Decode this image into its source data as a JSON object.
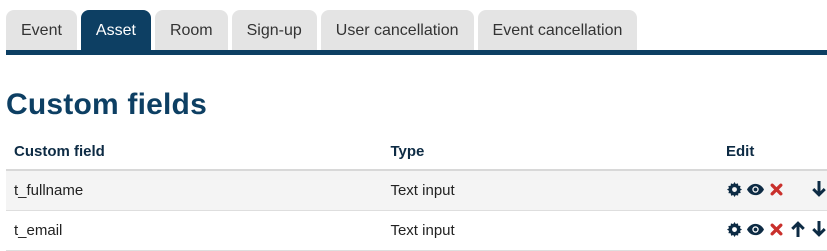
{
  "tabs": [
    {
      "label": "Event",
      "active": false
    },
    {
      "label": "Asset",
      "active": true
    },
    {
      "label": "Room",
      "active": false
    },
    {
      "label": "Sign-up",
      "active": false
    },
    {
      "label": "User cancellation",
      "active": false
    },
    {
      "label": "Event cancellation",
      "active": false
    }
  ],
  "page_title": "Custom fields",
  "table": {
    "headers": {
      "field": "Custom field",
      "type": "Type",
      "edit": "Edit"
    },
    "rows": [
      {
        "field": "t_fullname",
        "type": "Text input",
        "actions": [
          "settings-icon",
          "show-icon",
          "delete-icon",
          "move-down-icon"
        ]
      },
      {
        "field": "t_email",
        "type": "Text input",
        "actions": [
          "settings-icon",
          "show-icon",
          "delete-icon",
          "move-up-icon",
          "move-down-icon"
        ]
      }
    ]
  },
  "colors": {
    "accent": "#0d3f63",
    "delete": "#c9302c",
    "icon": "#0d2b44"
  }
}
